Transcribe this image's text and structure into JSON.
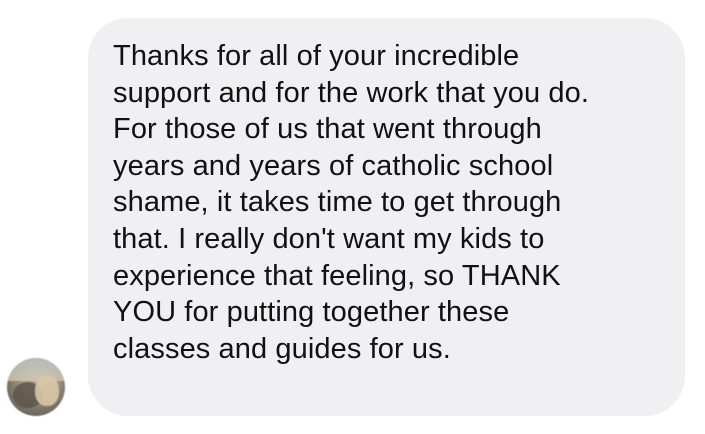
{
  "message": {
    "lines": [
      "Thanks for all of your incredible",
      "support and for the work that you do.",
      "For those of us that went through",
      "years and years of catholic school",
      "shame, it takes time to get through",
      "that. I really don't want my kids to",
      "experience that feeling, so THANK",
      "YOU for putting together these",
      "classes and guides for us."
    ]
  },
  "colors": {
    "bubble_background": "#f0f0f2",
    "text": "#111111",
    "page_background": "#ffffff"
  },
  "icons": {
    "avatar": "sender-avatar-photo"
  }
}
